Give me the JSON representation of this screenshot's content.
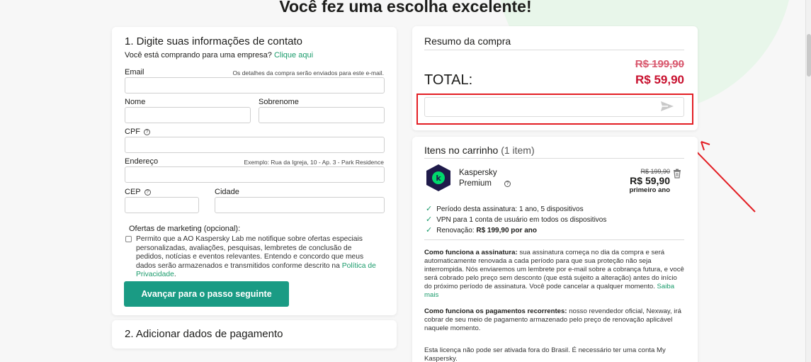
{
  "page": {
    "title": "Você fez uma escolha excelente!"
  },
  "contact": {
    "title": "1. Digite suas informações de contato",
    "business_prompt": "Você está comprando para uma empresa?",
    "business_link": "Clique aqui",
    "email_label": "Email",
    "email_hint": "Os detalhes da compra serão enviados para este e-mail.",
    "email_value": "",
    "first_name_label": "Nome",
    "last_name_label": "Sobrenome",
    "cpf_label": "CPF",
    "address_label": "Endereço",
    "address_hint": "Exemplo: Rua da Igreja, 10 - Ap. 3 - Park Residence",
    "cep_label": "CEP",
    "city_label": "Cidade",
    "marketing_title": "Ofertas de marketing (opcional):",
    "marketing_text": "Permito que a AO Kaspersky Lab me notifique sobre ofertas especiais personalizadas, avaliações, pesquisas, lembretes de conclusão de pedidos, notícias e eventos relevantes. Entendo e concordo que meus dados serão armazenados e transmitidos conforme descrito na",
    "privacy_link": "Política de Privacidade",
    "privacy_end": ".",
    "next_button": "Avançar para o passo seguinte"
  },
  "payment": {
    "title": "2. Adicionar dados de pagamento"
  },
  "summary": {
    "title": "Resumo da compra",
    "old_price": "R$ 199,90",
    "total_label": "TOTAL:",
    "total_price": "R$ 59,90",
    "coupon_value": ""
  },
  "cart": {
    "title": "Itens no carrinho",
    "count": "(1 item)",
    "product_name_1": "Kaspersky",
    "product_name_2": "Premium",
    "old_price": "R$ 199,90",
    "price": "R$ 59,90",
    "price_note": "primeiro ano",
    "features": [
      {
        "text": "Período desta assinatura: 1 ano, 5 dispositivos",
        "bold": ""
      },
      {
        "text": "VPN para 1 conta de usuário em todos os dispositivos",
        "bold": ""
      },
      {
        "text": "Renovação: ",
        "bold": "R$ 199,90 por ano"
      }
    ],
    "sub_heading": "Como funciona a assinatura:",
    "sub_text": "sua assinatura começa no dia da compra e será automaticamente renovada a cada período para que sua proteção não seja interrompida. Nós enviaremos um lembrete por e-mail sobre a cobrança futura, e você será cobrado pelo preço sem desconto (que está sujeito a alteração) antes do início do próximo período de assinatura. Você pode cancelar a qualquer momento.",
    "learn_more": "Saiba mais",
    "pay_heading": "Como funciona os pagamentos recorrentes:",
    "pay_text": "nosso revendedor oficial, Nexway, irá cobrar de seu meio de pagamento armazenado pelo preço de renovação aplicável naquele momento.",
    "license_text": "Esta licença não pode ser ativada fora do Brasil. É necessário ter uma conta My Kaspersky."
  },
  "colors": {
    "accent": "#1a9b84",
    "link": "#1a9b6b",
    "price_red": "#c8102e",
    "annotation_red": "#e31e24"
  },
  "icons": {
    "send": "send-icon",
    "trash": "trash-icon",
    "help": "help-icon",
    "check": "check-icon",
    "product": "kaspersky-logo"
  }
}
